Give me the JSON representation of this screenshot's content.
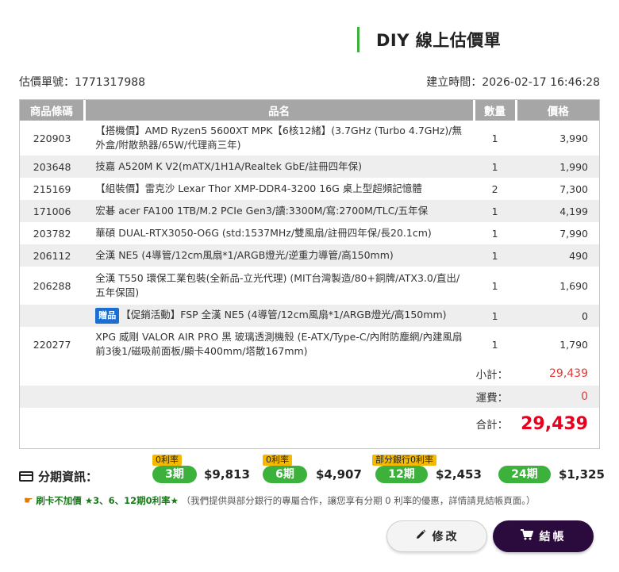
{
  "page": {
    "title": "DIY 線上估價單"
  },
  "meta": {
    "quote_no": "估價單號：1771317988",
    "created_at": "建立時間：2026-02-17 16:46:28"
  },
  "table": {
    "headers": {
      "code": "商品條碼",
      "name": "品名",
      "qty": "數量",
      "price": "價格"
    },
    "rows": [
      {
        "code": "220903",
        "name": "【搭機價】AMD Ryzen5 5600XT MPK【6核12緒】(3.7GHz (Turbo 4.7GHz)/無外盒/附散熱器/65W/代理商三年)",
        "qty": "1",
        "price": "3,990"
      },
      {
        "code": "203648",
        "name": "技嘉 A520M K V2(mATX/1H1A/Realtek GbE/註冊四年保)",
        "qty": "1",
        "price": "1,990"
      },
      {
        "code": "215169",
        "name": "【組裝價】雷克沙 Lexar Thor XMP-DDR4-3200 16G 桌上型超頻記憶體",
        "qty": "2",
        "price": "7,300"
      },
      {
        "code": "171006",
        "name": "宏碁 acer FA100 1TB/M.2 PCIe Gen3/讀:3300M/寫:2700M/TLC/五年保",
        "qty": "1",
        "price": "4,199"
      },
      {
        "code": "203782",
        "name": "華碩 DUAL-RTX3050-O6G (std:1537MHz/雙風扇/註冊四年保/長20.1cm)",
        "qty": "1",
        "price": "7,990"
      },
      {
        "code": "206112",
        "name": "全漢 NE5 (4導管/12cm風扇*1/ARGB燈光/逆重力導管/高150mm)",
        "qty": "1",
        "price": "490"
      },
      {
        "code": "206288",
        "name": "全漢 T550 環保工業包裝(全新品-立光代理) (MIT台灣製造/80+銅牌/ATX3.0/直出/五年保固)",
        "qty": "1",
        "price": "1,690"
      },
      {
        "code": "",
        "badge": "贈品",
        "name": "【促銷活動】FSP 全漢 NE5 (4導管/12cm風扇*1/ARGB燈光/高150mm)",
        "qty": "1",
        "price": "0"
      },
      {
        "code": "220277",
        "name": "XPG 威剛 VALOR AIR PRO 黑 玻璃透測機殼 (E-ATX/Type-C/內附防塵網/內建風扇前3後1/磁吸前面板/顯卡400mm/塔散167mm)",
        "qty": "1",
        "price": "1,790"
      }
    ]
  },
  "summary": {
    "subtotal_label": "小計：",
    "subtotal": "29,439",
    "shipping_label": "運費：",
    "shipping": "0",
    "total_label": "合計：",
    "total": "29,439"
  },
  "installments": {
    "label": "分期資訊：",
    "plans": [
      {
        "tag": "0利率",
        "term": "3期",
        "amount": "$9,813"
      },
      {
        "tag": "0利率",
        "term": "6期",
        "amount": "$4,907"
      },
      {
        "tag": "部分銀行0利率",
        "term": "12期",
        "amount": "$2,453"
      },
      {
        "tag": "",
        "term": "24期",
        "amount": "$1,325"
      }
    ]
  },
  "notice": {
    "hand": "☛",
    "strong": "刷卡不加價 ★3、6、12期0利率★",
    "text": "（我們提供與部分銀行的專屬合作，讓您享有分期 0 利率的優惠，詳情請見結帳頁面。）"
  },
  "buttons": {
    "edit": "修改",
    "checkout": "結帳"
  },
  "colors": {
    "accent_green": "#3cb23c",
    "checkout_bg": "#2b0a3d",
    "total_red": "#e8001d",
    "tag_yellow": "#f5b800"
  }
}
